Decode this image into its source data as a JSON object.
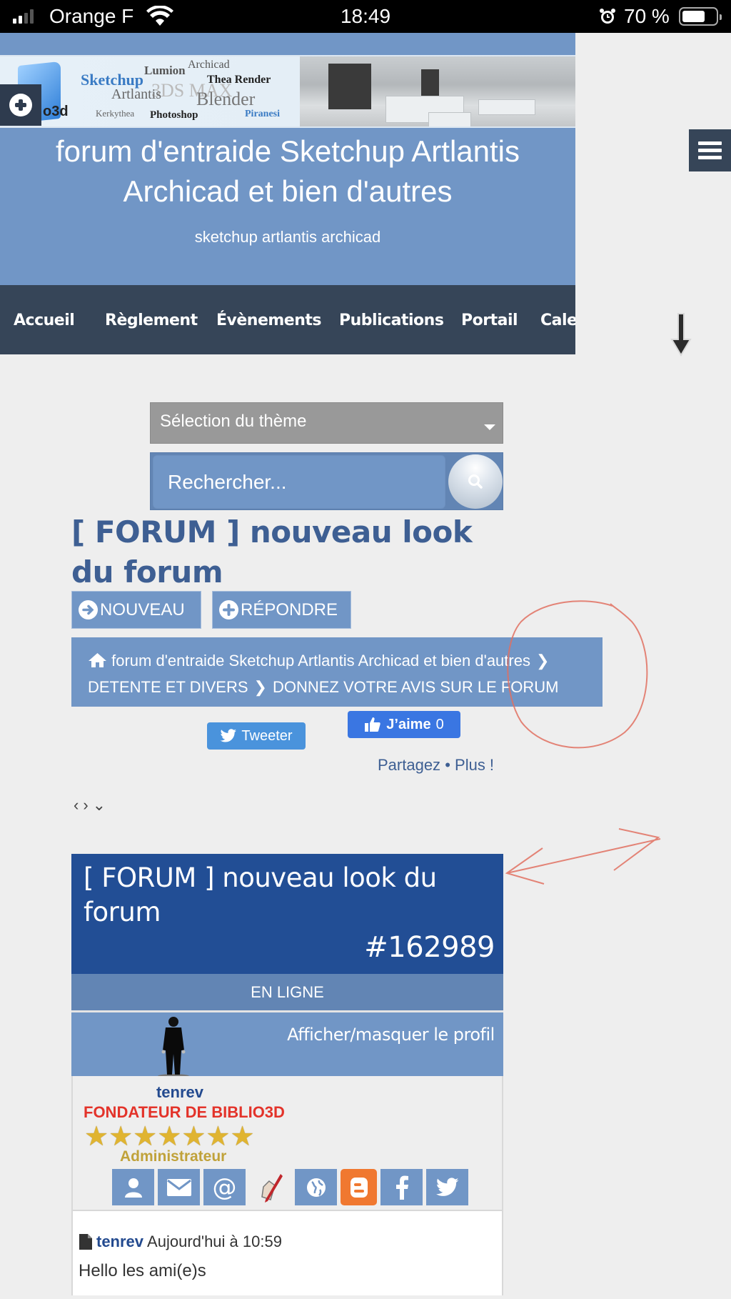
{
  "status_bar": {
    "carrier": "Orange F",
    "time": "18:49",
    "battery_percent_label": "70 %",
    "battery_level": 0.7,
    "signal_bars_active": 2,
    "signal_bars_total": 4
  },
  "banner": {
    "logo_text": "o3d",
    "words": [
      "Sketchup",
      "Lumion",
      "Archicad",
      "Thea Render",
      "3DS MAX",
      "Artlantis",
      "Blender",
      "Kerkythea",
      "Photoshop",
      "Piranesi"
    ]
  },
  "header": {
    "title": "forum d'entraide Sketchup Artlantis Archicad et bien d'autres",
    "subtitle": "sketchup artlantis archicad"
  },
  "nav": {
    "items": [
      "Accueil",
      "Règlement",
      "Évènements",
      "Publications",
      "Portail",
      "Calendrier"
    ]
  },
  "theme_select": {
    "selected": "Sélection du thème"
  },
  "search": {
    "placeholder": "Rechercher..."
  },
  "topic": {
    "title": "[ FORUM ] nouveau look du forum"
  },
  "actions": {
    "new_label": "NOUVEAU",
    "reply_label": "RÉPONDRE"
  },
  "breadcrumb": {
    "items": [
      "forum d'entraide Sketchup Artlantis Archicad et bien d'autres",
      "DETENTE ET DIVERS",
      "DONNEZ VOTRE AVIS SUR LE FORUM"
    ]
  },
  "social": {
    "tweet_label": "Tweeter",
    "like_label": "J’aime",
    "like_count": "0",
    "share_label": "Partagez",
    "separator": "•",
    "more_label": "Plus !"
  },
  "post": {
    "title": "[ FORUM ] nouveau look du forum",
    "id": "#162989",
    "online_status": "EN LIGNE",
    "toggle_profile_label": "Afficher/masquer le profil",
    "author": "tenrev",
    "rank_title": "FONDATEUR DE BIBLIO3D",
    "stars": 7,
    "role": "Administrateur",
    "contact_icons": [
      "profile-icon",
      "private-message-icon",
      "email-icon",
      "sketchup-icon",
      "website-icon",
      "blogger-icon",
      "facebook-icon",
      "twitter-icon"
    ],
    "date": "Aujourd'hui à 10:59",
    "body": "Hello les ami(e)s"
  },
  "colors": {
    "header_blue": "#7196c6",
    "nav_dark": "#364558",
    "post_head_blue": "#224e95",
    "rank_red": "#e3332a",
    "annotation_red": "#e07060"
  }
}
